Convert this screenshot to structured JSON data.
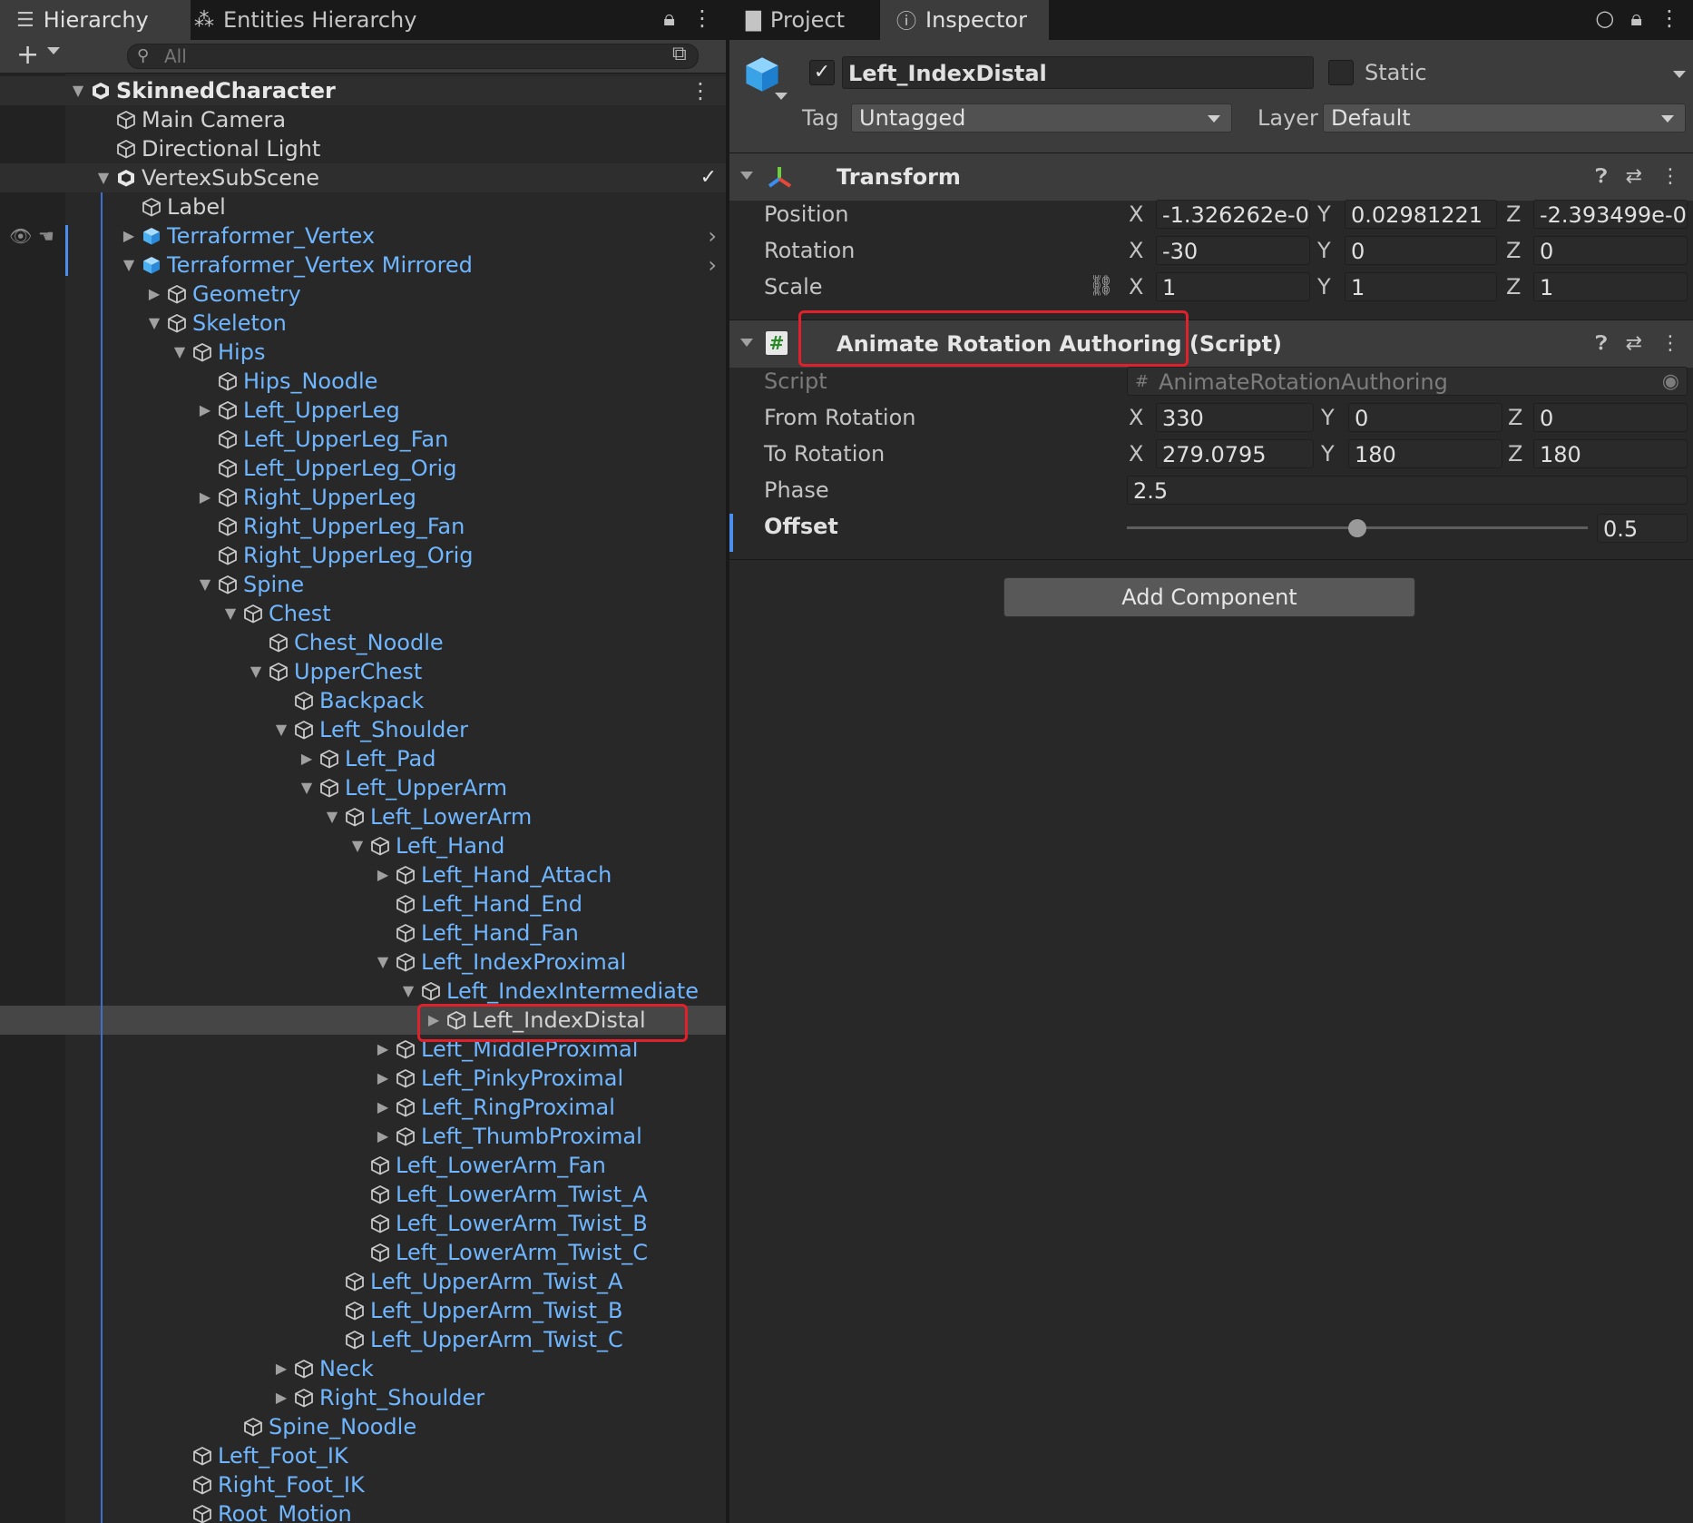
{
  "hierarchy": {
    "tabs": [
      {
        "label": "Hierarchy",
        "icon": "list-icon"
      },
      {
        "label": "Entities Hierarchy",
        "icon": "entities-icon"
      }
    ],
    "search_placeholder": "All",
    "rows": [
      {
        "label": "SkinnedCharacter",
        "depth": 0,
        "arrow": "open",
        "style": "root",
        "icon": "scene"
      },
      {
        "label": "Main Camera",
        "depth": 1,
        "arrow": "",
        "style": "default",
        "icon": "cube"
      },
      {
        "label": "Directional Light",
        "depth": 1,
        "arrow": "",
        "style": "default",
        "icon": "cube"
      },
      {
        "label": "VertexSubScene",
        "depth": 1,
        "arrow": "open",
        "style": "subscene",
        "icon": "scene"
      },
      {
        "label": "Label",
        "depth": 2,
        "arrow": "",
        "style": "default",
        "icon": "cube"
      },
      {
        "label": "Terraformer_Vertex",
        "depth": 2,
        "arrow": "closed",
        "style": "prefab-root",
        "icon": "prefab"
      },
      {
        "label": "Terraformer_Vertex Mirrored",
        "depth": 2,
        "arrow": "open",
        "style": "prefab-root",
        "icon": "prefab"
      },
      {
        "label": "Geometry",
        "depth": 3,
        "arrow": "closed",
        "style": "prefab",
        "icon": "cube"
      },
      {
        "label": "Skeleton",
        "depth": 3,
        "arrow": "open",
        "style": "prefab",
        "icon": "cube"
      },
      {
        "label": "Hips",
        "depth": 4,
        "arrow": "open",
        "style": "prefab",
        "icon": "cube"
      },
      {
        "label": "Hips_Noodle",
        "depth": 5,
        "arrow": "",
        "style": "prefab",
        "icon": "cube"
      },
      {
        "label": "Left_UpperLeg",
        "depth": 5,
        "arrow": "closed",
        "style": "prefab",
        "icon": "cube"
      },
      {
        "label": "Left_UpperLeg_Fan",
        "depth": 5,
        "arrow": "",
        "style": "prefab",
        "icon": "cube"
      },
      {
        "label": "Left_UpperLeg_Orig",
        "depth": 5,
        "arrow": "",
        "style": "prefab",
        "icon": "cube"
      },
      {
        "label": "Right_UpperLeg",
        "depth": 5,
        "arrow": "closed",
        "style": "prefab",
        "icon": "cube"
      },
      {
        "label": "Right_UpperLeg_Fan",
        "depth": 5,
        "arrow": "",
        "style": "prefab",
        "icon": "cube"
      },
      {
        "label": "Right_UpperLeg_Orig",
        "depth": 5,
        "arrow": "",
        "style": "prefab",
        "icon": "cube"
      },
      {
        "label": "Spine",
        "depth": 5,
        "arrow": "open",
        "style": "prefab",
        "icon": "cube"
      },
      {
        "label": "Chest",
        "depth": 6,
        "arrow": "open",
        "style": "prefab",
        "icon": "cube"
      },
      {
        "label": "Chest_Noodle",
        "depth": 7,
        "arrow": "",
        "style": "prefab",
        "icon": "cube"
      },
      {
        "label": "UpperChest",
        "depth": 7,
        "arrow": "open",
        "style": "prefab",
        "icon": "cube"
      },
      {
        "label": "Backpack",
        "depth": 8,
        "arrow": "",
        "style": "prefab",
        "icon": "cube"
      },
      {
        "label": "Left_Shoulder",
        "depth": 8,
        "arrow": "open",
        "style": "prefab",
        "icon": "cube"
      },
      {
        "label": "Left_Pad",
        "depth": 9,
        "arrow": "closed",
        "style": "prefab",
        "icon": "cube"
      },
      {
        "label": "Left_UpperArm",
        "depth": 9,
        "arrow": "open",
        "style": "prefab",
        "icon": "cube"
      },
      {
        "label": "Left_LowerArm",
        "depth": 10,
        "arrow": "open",
        "style": "prefab",
        "icon": "cube"
      },
      {
        "label": "Left_Hand",
        "depth": 11,
        "arrow": "open",
        "style": "prefab",
        "icon": "cube"
      },
      {
        "label": "Left_Hand_Attach",
        "depth": 12,
        "arrow": "closed",
        "style": "prefab",
        "icon": "cube"
      },
      {
        "label": "Left_Hand_End",
        "depth": 12,
        "arrow": "",
        "style": "prefab",
        "icon": "cube"
      },
      {
        "label": "Left_Hand_Fan",
        "depth": 12,
        "arrow": "",
        "style": "prefab",
        "icon": "cube"
      },
      {
        "label": "Left_IndexProximal",
        "depth": 12,
        "arrow": "open",
        "style": "prefab",
        "icon": "cube"
      },
      {
        "label": "Left_IndexIntermediate",
        "depth": 13,
        "arrow": "open",
        "style": "prefab",
        "icon": "cube"
      },
      {
        "label": "Left_IndexDistal",
        "depth": 14,
        "arrow": "closed",
        "style": "selected",
        "icon": "cube"
      },
      {
        "label": "Left_MiddleProximal",
        "depth": 12,
        "arrow": "closed",
        "style": "prefab",
        "icon": "cube"
      },
      {
        "label": "Left_PinkyProximal",
        "depth": 12,
        "arrow": "closed",
        "style": "prefab",
        "icon": "cube"
      },
      {
        "label": "Left_RingProximal",
        "depth": 12,
        "arrow": "closed",
        "style": "prefab",
        "icon": "cube"
      },
      {
        "label": "Left_ThumbProximal",
        "depth": 12,
        "arrow": "closed",
        "style": "prefab",
        "icon": "cube"
      },
      {
        "label": "Left_LowerArm_Fan",
        "depth": 11,
        "arrow": "",
        "style": "prefab",
        "icon": "cube"
      },
      {
        "label": "Left_LowerArm_Twist_A",
        "depth": 11,
        "arrow": "",
        "style": "prefab",
        "icon": "cube"
      },
      {
        "label": "Left_LowerArm_Twist_B",
        "depth": 11,
        "arrow": "",
        "style": "prefab",
        "icon": "cube"
      },
      {
        "label": "Left_LowerArm_Twist_C",
        "depth": 11,
        "arrow": "",
        "style": "prefab",
        "icon": "cube"
      },
      {
        "label": "Left_UpperArm_Twist_A",
        "depth": 10,
        "arrow": "",
        "style": "prefab",
        "icon": "cube"
      },
      {
        "label": "Left_UpperArm_Twist_B",
        "depth": 10,
        "arrow": "",
        "style": "prefab",
        "icon": "cube"
      },
      {
        "label": "Left_UpperArm_Twist_C",
        "depth": 10,
        "arrow": "",
        "style": "prefab",
        "icon": "cube"
      },
      {
        "label": "Neck",
        "depth": 8,
        "arrow": "closed",
        "style": "prefab",
        "icon": "cube"
      },
      {
        "label": "Right_Shoulder",
        "depth": 8,
        "arrow": "closed",
        "style": "prefab",
        "icon": "cube"
      },
      {
        "label": "Spine_Noodle",
        "depth": 6,
        "arrow": "",
        "style": "prefab",
        "icon": "cube"
      },
      {
        "label": "Left_Foot_IK",
        "depth": 4,
        "arrow": "",
        "style": "prefab",
        "icon": "cube"
      },
      {
        "label": "Right_Foot_IK",
        "depth": 4,
        "arrow": "",
        "style": "prefab",
        "icon": "cube"
      },
      {
        "label": "Root_Motion",
        "depth": 4,
        "arrow": "",
        "style": "prefab",
        "icon": "cube"
      }
    ]
  },
  "inspector": {
    "tabs": [
      {
        "label": "Project",
        "icon": "folder-icon"
      },
      {
        "label": "Inspector",
        "icon": "info-icon"
      }
    ],
    "object": {
      "active": true,
      "name": "Left_IndexDistal",
      "static_label": "Static",
      "tag_label": "Tag",
      "tag_value": "Untagged",
      "layer_label": "Layer",
      "layer_value": "Default"
    },
    "transform": {
      "title": "Transform",
      "position": {
        "label": "Position",
        "x": "-1.326262e-0",
        "y": "0.02981221",
        "z": "-2.393499e-0"
      },
      "rotation": {
        "label": "Rotation",
        "x": "-30",
        "y": "0",
        "z": "0"
      },
      "scale": {
        "label": "Scale",
        "x": "1",
        "y": "1",
        "z": "1"
      }
    },
    "script_component": {
      "title": "Animate Rotation Authoring (Script)",
      "script_label": "Script",
      "script_value": "AnimateRotationAuthoring",
      "from_rotation": {
        "label": "From Rotation",
        "x": "330",
        "y": "0",
        "z": "0"
      },
      "to_rotation": {
        "label": "To Rotation",
        "x": "279.0795",
        "y": "180",
        "z": "180"
      },
      "phase": {
        "label": "Phase",
        "value": "2.5"
      },
      "offset": {
        "label": "Offset",
        "value": "0.5",
        "fraction": 0.5
      }
    },
    "axis_labels": {
      "x": "X",
      "y": "Y",
      "z": "Z"
    },
    "add_component_label": "Add Component"
  },
  "colors": {
    "prefab_text": "#6fb6ff",
    "highlight_box": "#e0202a",
    "selection_marker": "#4a8ef0"
  }
}
